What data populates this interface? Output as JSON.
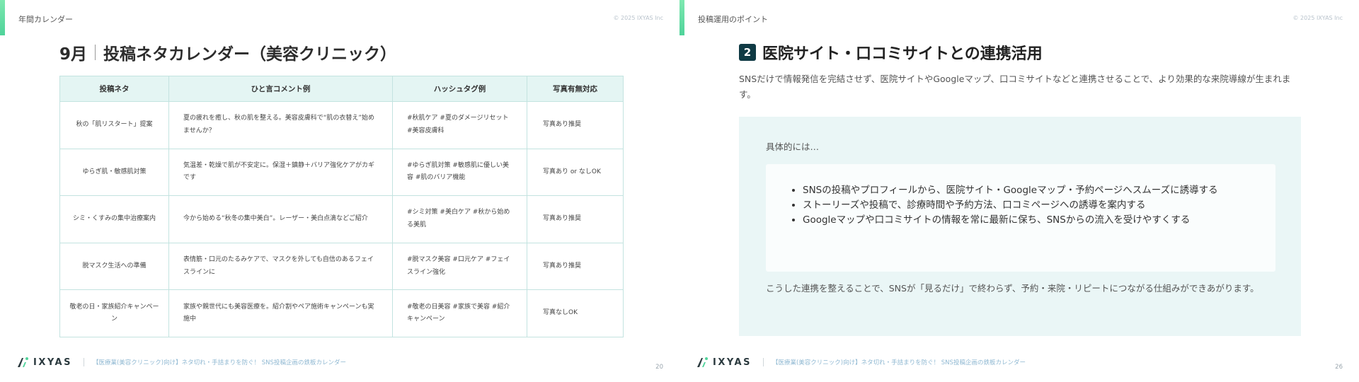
{
  "left_slide": {
    "section_label": "年間カレンダー",
    "copyright": "© 2025 IXYAS Inc",
    "title_month": "9月",
    "title_main": "投稿ネタカレンダー（美容クリニック）",
    "table": {
      "headers": [
        "投稿ネタ",
        "ひと言コメント例",
        "ハッシュタグ例",
        "写真有無対応"
      ],
      "rows": [
        {
          "topic": "秋の「肌リスタート」提案",
          "comment": "夏の疲れを癒し、秋の肌を整える。美容皮膚科で“肌の衣替え”始めませんか？",
          "hashtags": "#秋肌ケア #夏のダメージリセット #美容皮膚科",
          "photo": "写真あり推奨"
        },
        {
          "topic": "ゆらぎ肌・敏感肌対策",
          "comment": "気温差・乾燥で肌が不安定に。保湿＋鎮静＋バリア強化ケアがカギです",
          "hashtags": "#ゆらぎ肌対策 #敏感肌に優しい美容 #肌のバリア機能",
          "photo": "写真あり or なしOK"
        },
        {
          "topic": "シミ・くすみの集中治療案内",
          "comment": "今から始める“秋冬の集中美白”。レーザー・美白点滴などご紹介",
          "hashtags": "#シミ対策 #美白ケア #秋から始める美肌",
          "photo": "写真あり推奨"
        },
        {
          "topic": "脱マスク生活への準備",
          "comment": "表情筋・口元のたるみケアで、マスクを外しても自信のあるフェイスラインに",
          "hashtags": "#脱マスク美容 #口元ケア #フェイスライン強化",
          "photo": "写真あり推奨"
        },
        {
          "topic": "敬老の日・家族紹介キャンペーン",
          "comment": "家族や親世代にも美容医療を。紹介割やペア施術キャンペーンも実施中",
          "hashtags": "#敬老の日美容 #家族で美容 #紹介キャンペーン",
          "photo": "写真なしOK"
        }
      ]
    },
    "footer": {
      "brand": "IXYAS",
      "text": "【医療業(美容クリニック)向け】ネタ切れ・手詰まりを防ぐ！ SNS投稿企画の鉄板カレンダー",
      "page": "20"
    }
  },
  "right_slide": {
    "section_label": "投稿運用のポイント",
    "copyright": "© 2025 IXYAS Inc",
    "number": "2",
    "title": "医院サイト・口コミサイトとの連携活用",
    "intro": "SNSだけで情報発信を完結させず、医院サイトやGoogleマップ、口コミサイトなどと連携させることで、より効果的な来院導線が生まれます。",
    "panel_heading": "具体的には…",
    "bullets": [
      "SNSの投稿やプロフィールから、医院サイト・Googleマップ・予約ページへスムーズに誘導する",
      "ストーリーズや投稿で、診療時間や予約方法、口コミページへの誘導を案内する",
      "Googleマップや口コミサイトの情報を常に最新に保ち、SNSからの流入を受けやすくする"
    ],
    "closing": "こうした連携を整えることで、SNSが「見るだけ」で終わらず、予約・来院・リピートにつながる仕組みができあがります。",
    "footer": {
      "brand": "IXYAS",
      "text": "【医療業(美容クリニック)向け】ネタ切れ・手詰まりを防ぐ！ SNS投稿企画の鉄板カレンダー",
      "page": "26"
    }
  },
  "colors": {
    "accent_green": "#4fd39a",
    "table_header_bg": "#e4f5f3",
    "table_border": "#c3e3e0",
    "panel_bg": "#eaf6f6",
    "badge_bg": "#0f3a44"
  }
}
